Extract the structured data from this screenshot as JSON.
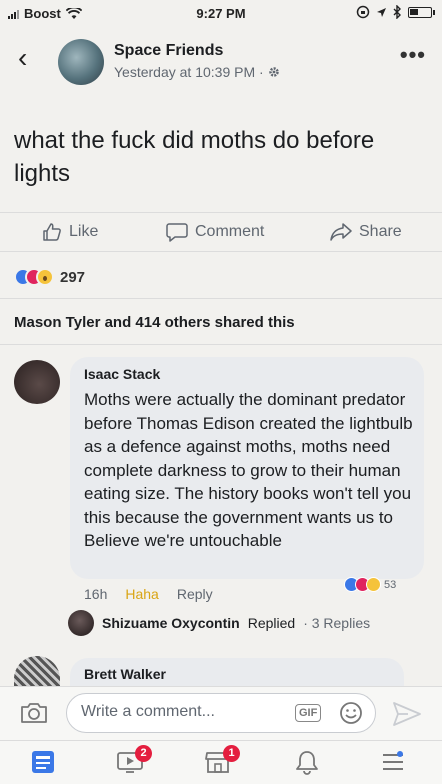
{
  "status_bar": {
    "carrier": "Boost",
    "time": "9:27 PM"
  },
  "post": {
    "page_name": "Space Friends",
    "timestamp": "Yesterday at 10:39 PM ·",
    "text": "what the fuck did moths do before lights"
  },
  "actions": {
    "like": "Like",
    "comment": "Comment",
    "share": "Share"
  },
  "reactions": {
    "count": "297"
  },
  "shares": {
    "text": "Mason Tyler and 414 others shared this"
  },
  "comments": [
    {
      "author": "Isaac Stack",
      "text": "Moths were actually the dominant predator before Thomas Edison created the lightbulb as a defence against moths, moths need complete darkness to grow to their human eating size. The history books won't tell you this because the government wants us to Believe we're untouchable",
      "time": "16h",
      "haha_label": "Haha",
      "reply_label": "Reply",
      "reaction_count": "53",
      "reply": {
        "name": "Shizuame Oxycontin",
        "action": "Replied",
        "count": "· 3 Replies"
      }
    },
    {
      "author": "Brett Walker"
    }
  ],
  "composer": {
    "placeholder": "Write a comment...",
    "gif_label": "GIF"
  },
  "tabbar": {
    "badge_videos": "2",
    "badge_marketplace": "1"
  },
  "colors": {
    "like_blue": "#3b78e7",
    "love_red": "#e0245e",
    "haha_yellow": "#d9a514",
    "badge_red": "#e41e3f"
  }
}
